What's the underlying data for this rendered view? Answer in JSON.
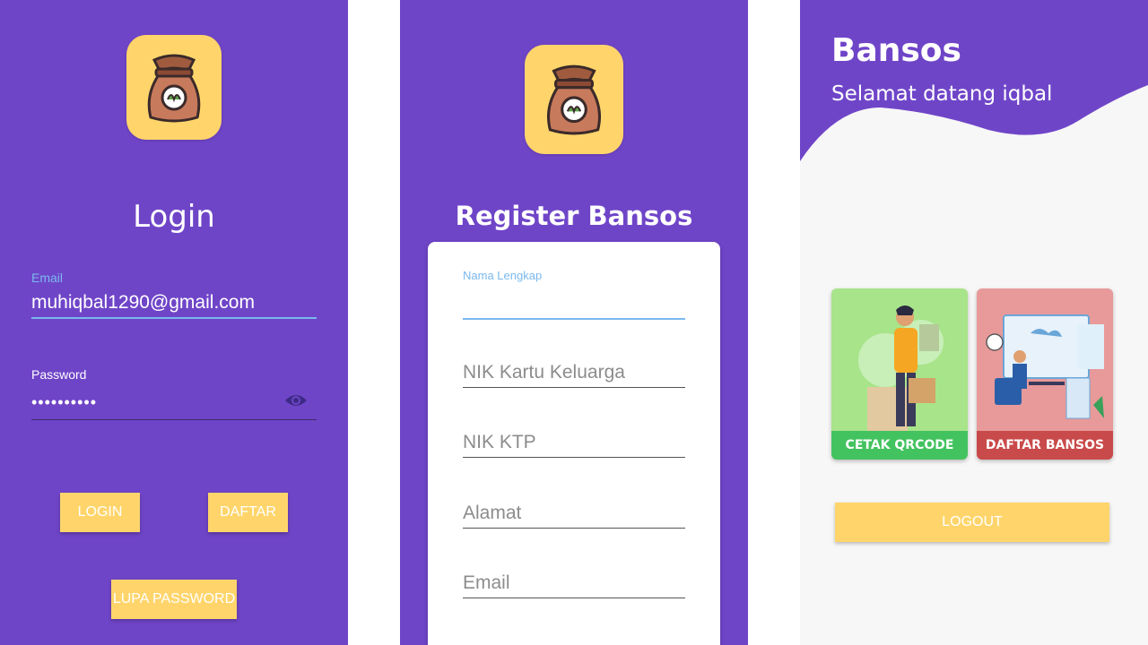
{
  "login": {
    "title": "Login",
    "email": {
      "label": "Email",
      "value": "muhiqbal1290@gmail.com"
    },
    "password": {
      "label": "Password",
      "value": "••••••••••"
    },
    "login_button": "LOGIN",
    "daftar_button": "DAFTAR",
    "lupa_password_button": "LUPA PASSWORD",
    "colors": {
      "background": "#6f45c8",
      "button": "#ffd56b",
      "focus": "#7ab8ee"
    }
  },
  "register": {
    "title": "Register Bansos",
    "fields": [
      {
        "label": "Nama Lengkap"
      },
      {
        "placeholder": "NIK Kartu Keluarga"
      },
      {
        "placeholder": "NIK KTP"
      },
      {
        "placeholder": "Alamat"
      },
      {
        "placeholder": "Email"
      }
    ]
  },
  "home": {
    "title": "Bansos",
    "subtitle": "Selamat datang iqbal",
    "menu": [
      {
        "label": "CETAK QRCODE",
        "color": "#43c35f",
        "bg": "#a8e48a"
      },
      {
        "label": "DAFTAR BANSOS",
        "color": "#c94a4a",
        "bg": "#e89a9a"
      }
    ],
    "logout_button": "LOGOUT"
  }
}
